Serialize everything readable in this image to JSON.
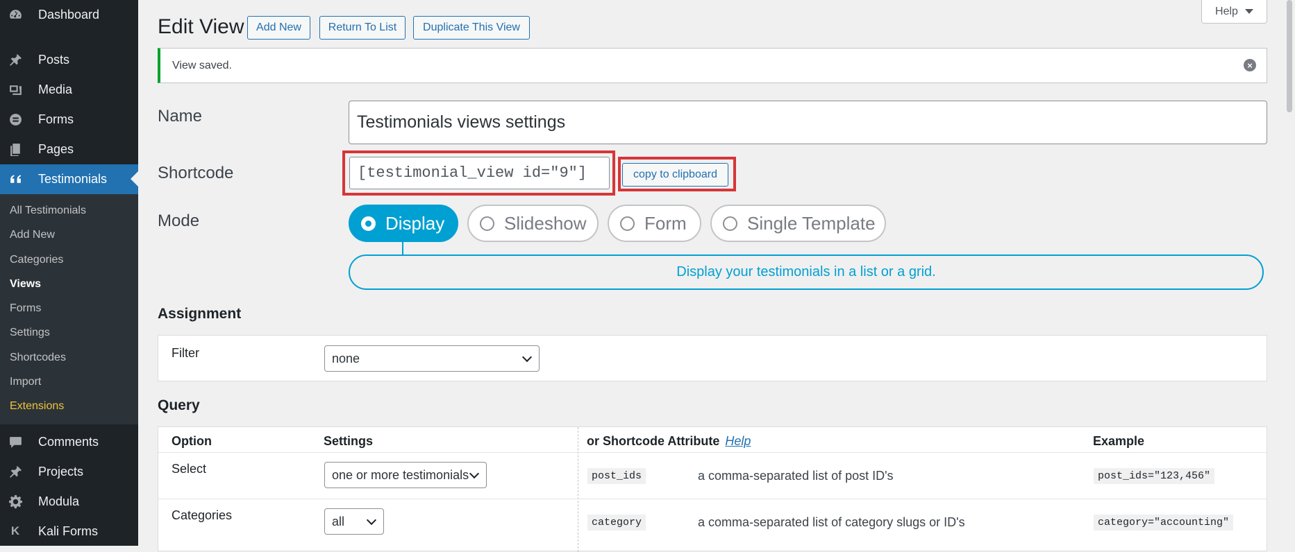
{
  "sidebar": {
    "items": [
      {
        "label": "Dashboard"
      },
      {
        "label": "Posts"
      },
      {
        "label": "Media"
      },
      {
        "label": "Forms"
      },
      {
        "label": "Pages"
      },
      {
        "label": "Testimonials"
      },
      {
        "label": "Comments"
      },
      {
        "label": "Projects"
      },
      {
        "label": "Modula"
      },
      {
        "label": "Kali Forms"
      }
    ],
    "submenu": [
      {
        "label": "All Testimonials"
      },
      {
        "label": "Add New"
      },
      {
        "label": "Categories"
      },
      {
        "label": "Views"
      },
      {
        "label": "Forms"
      },
      {
        "label": "Settings"
      },
      {
        "label": "Shortcodes"
      },
      {
        "label": "Import"
      },
      {
        "label": "Extensions"
      }
    ]
  },
  "header": {
    "title": "Edit View",
    "buttons": {
      "add_new": "Add New",
      "return_to_list": "Return To List",
      "duplicate": "Duplicate This View"
    },
    "help": "Help"
  },
  "notice": {
    "text": "View saved.",
    "dismiss": "×"
  },
  "form": {
    "name_label": "Name",
    "name_value": "Testimonials views settings",
    "shortcode_label": "Shortcode",
    "shortcode_value": "[testimonial_view id=\"9\"]",
    "copy_button": "copy to clipboard",
    "mode_label": "Mode",
    "modes": [
      {
        "label": "Display",
        "selected": true
      },
      {
        "label": "Slideshow",
        "selected": false
      },
      {
        "label": "Form",
        "selected": false
      },
      {
        "label": "Single Template",
        "selected": false
      }
    ],
    "mode_description": "Display your testimonials in a list or a grid."
  },
  "assignment": {
    "heading": "Assignment",
    "filter_label": "Filter",
    "filter_value": "none"
  },
  "query": {
    "heading": "Query",
    "columns": {
      "option": "Option",
      "settings": "Settings",
      "shortcode_attr": "or Shortcode Attribute",
      "help_link": "Help",
      "example": "Example"
    },
    "rows": [
      {
        "option": "Select",
        "setting": "one or more testimonials",
        "attr": "post_ids",
        "desc": "a comma-separated list of post ID's",
        "example": "post_ids=\"123,456\""
      },
      {
        "option": "Categories",
        "setting": "all",
        "attr": "category",
        "desc": "a comma-separated list of category slugs or ID's",
        "example": "category=\"accounting\""
      }
    ]
  },
  "colors": {
    "accent": "#2271b1",
    "mode_active": "#00a0d2",
    "highlight": "#d63638",
    "notice_success": "#00a32a",
    "sidebar_bg": "#1d2327",
    "extensions": "#f0c33c"
  }
}
